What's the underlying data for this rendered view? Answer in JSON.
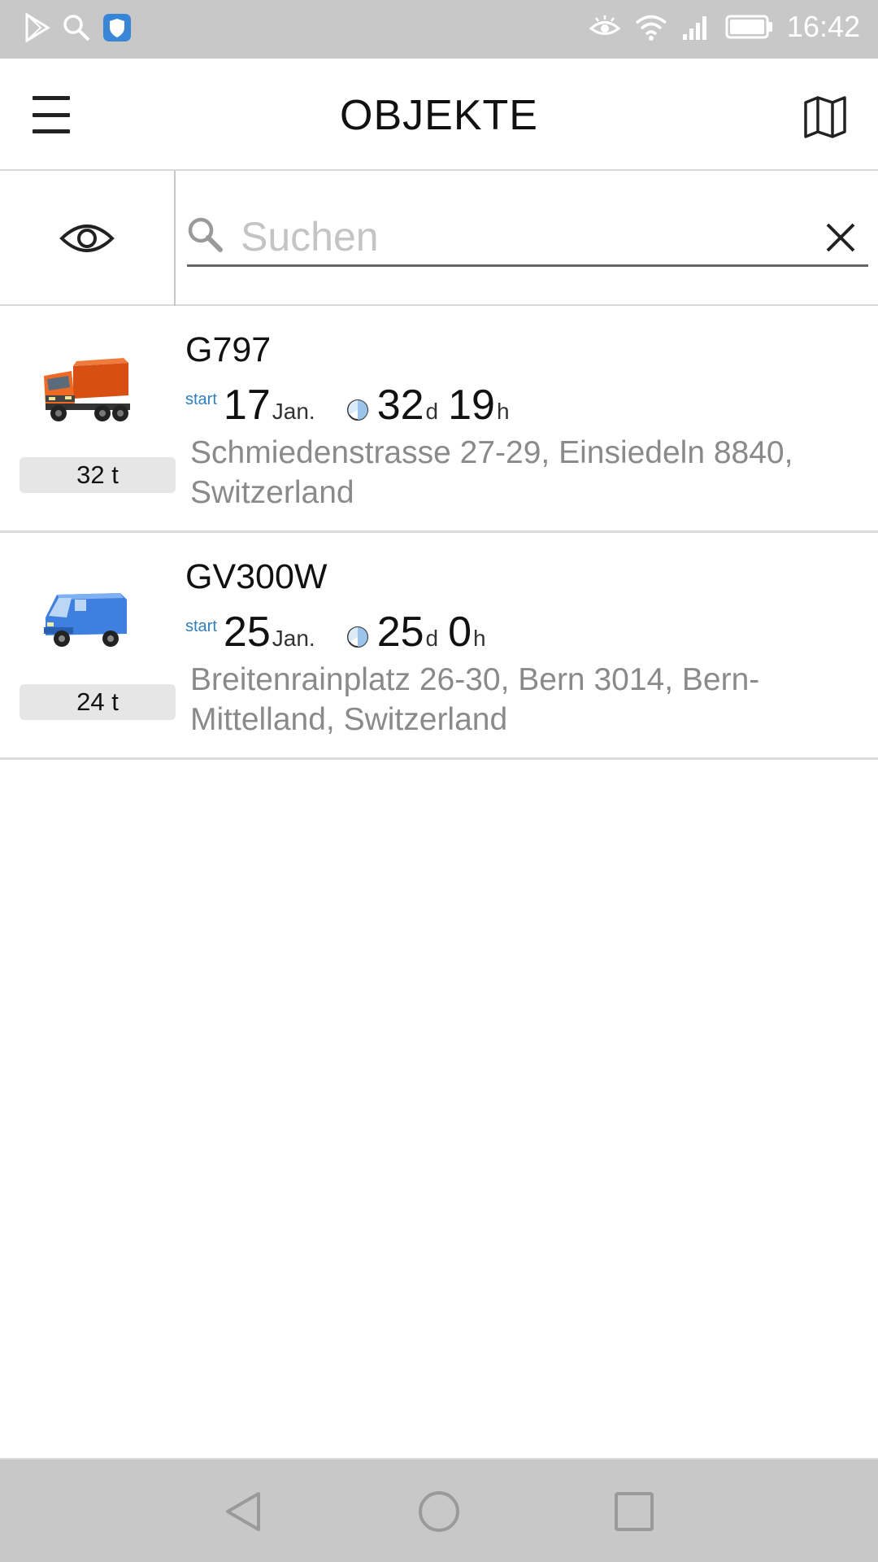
{
  "status_bar": {
    "time": "16:42",
    "left_icons": [
      "play-store-icon",
      "search-icon",
      "shield-app-icon"
    ],
    "right_icons": [
      "eye-comfort-icon",
      "wifi-icon",
      "signal-icon",
      "battery-icon"
    ]
  },
  "app_bar": {
    "title": "OBJEKTE",
    "left_icon": "menu-icon",
    "right_icon": "map-icon"
  },
  "search": {
    "placeholder": "Suchen",
    "value": "",
    "filter_icon": "eye-icon",
    "clear_icon": "close-icon"
  },
  "objects": [
    {
      "name": "G797",
      "weight": "32 t",
      "vehicle_icon": "orange-truck-icon",
      "start_label": "start",
      "start_day": "17",
      "start_month": "Jan.",
      "duration_days": "32",
      "duration_days_unit": "d",
      "duration_hours": "19",
      "duration_hours_unit": "h",
      "address": "Schmiedenstrasse 27-29, Einsiedeln 8840, Switzerland"
    },
    {
      "name": "GV300W",
      "weight": "24 t",
      "vehicle_icon": "blue-van-icon",
      "start_label": "start",
      "start_day": "25",
      "start_month": "Jan.",
      "duration_days": "25",
      "duration_days_unit": "d",
      "duration_hours": "0",
      "duration_hours_unit": "h",
      "address": "Breitenrainplatz 26-30, Bern 3014, Bern-Mittelland, Switzerland"
    }
  ],
  "nav_bar": {
    "icons": [
      "back-icon",
      "home-icon",
      "recents-icon"
    ]
  },
  "colors": {
    "status_bar": "#c8c8c8",
    "start_label": "#2f7fc1",
    "address_text": "#8a8a8a",
    "badge_bg": "#e6e6e6"
  }
}
